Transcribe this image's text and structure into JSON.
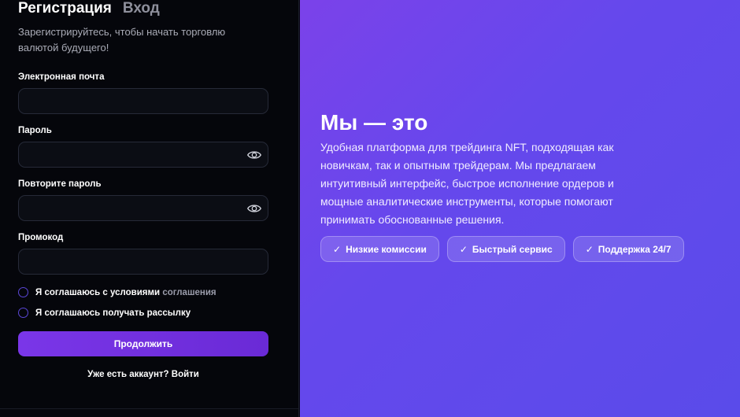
{
  "tabs": {
    "register": "Регистрация",
    "login": "Вход"
  },
  "subtitle": "Зарегистрируйтесь, чтобы начать торговлю валютой будущего!",
  "fields": {
    "email": {
      "label": "Электронная почта",
      "value": ""
    },
    "password": {
      "label": "Пароль",
      "value": ""
    },
    "password_repeat": {
      "label": "Повторите пароль",
      "value": ""
    },
    "promo": {
      "label": "Промокод",
      "value": ""
    }
  },
  "agreements": {
    "terms_text": "Я соглашаюсь с условиями",
    "terms_link": "соглашения",
    "newsletter": "Я соглашаюсь получать рассылку"
  },
  "submit_label": "Продолжить",
  "have_account": {
    "text": "Уже есть аккаунт?",
    "link": "Войти"
  },
  "hero": {
    "title": "Мы — это",
    "text": "Удобная платформа для трейдинга NFT, подходящая как новичкам, так и опытным трейдерам. Мы предлагаем интуитивный интерфейс, быстрое исполнение ордеров и мощные аналитические инструменты, которые помогают принимать обоснованные решения."
  },
  "chips": [
    {
      "tick": "✓",
      "label": "Низкие комиссии"
    },
    {
      "tick": "✓",
      "label": "Быстрый сервис"
    },
    {
      "tick": "✓",
      "label": "Поддержка 24/7"
    }
  ],
  "colors": {
    "accent": "#7a36e8",
    "panel_bg": "#05060b",
    "hero_bg": "#6548ec"
  },
  "icons": {
    "password_toggle": "eye-icon"
  }
}
